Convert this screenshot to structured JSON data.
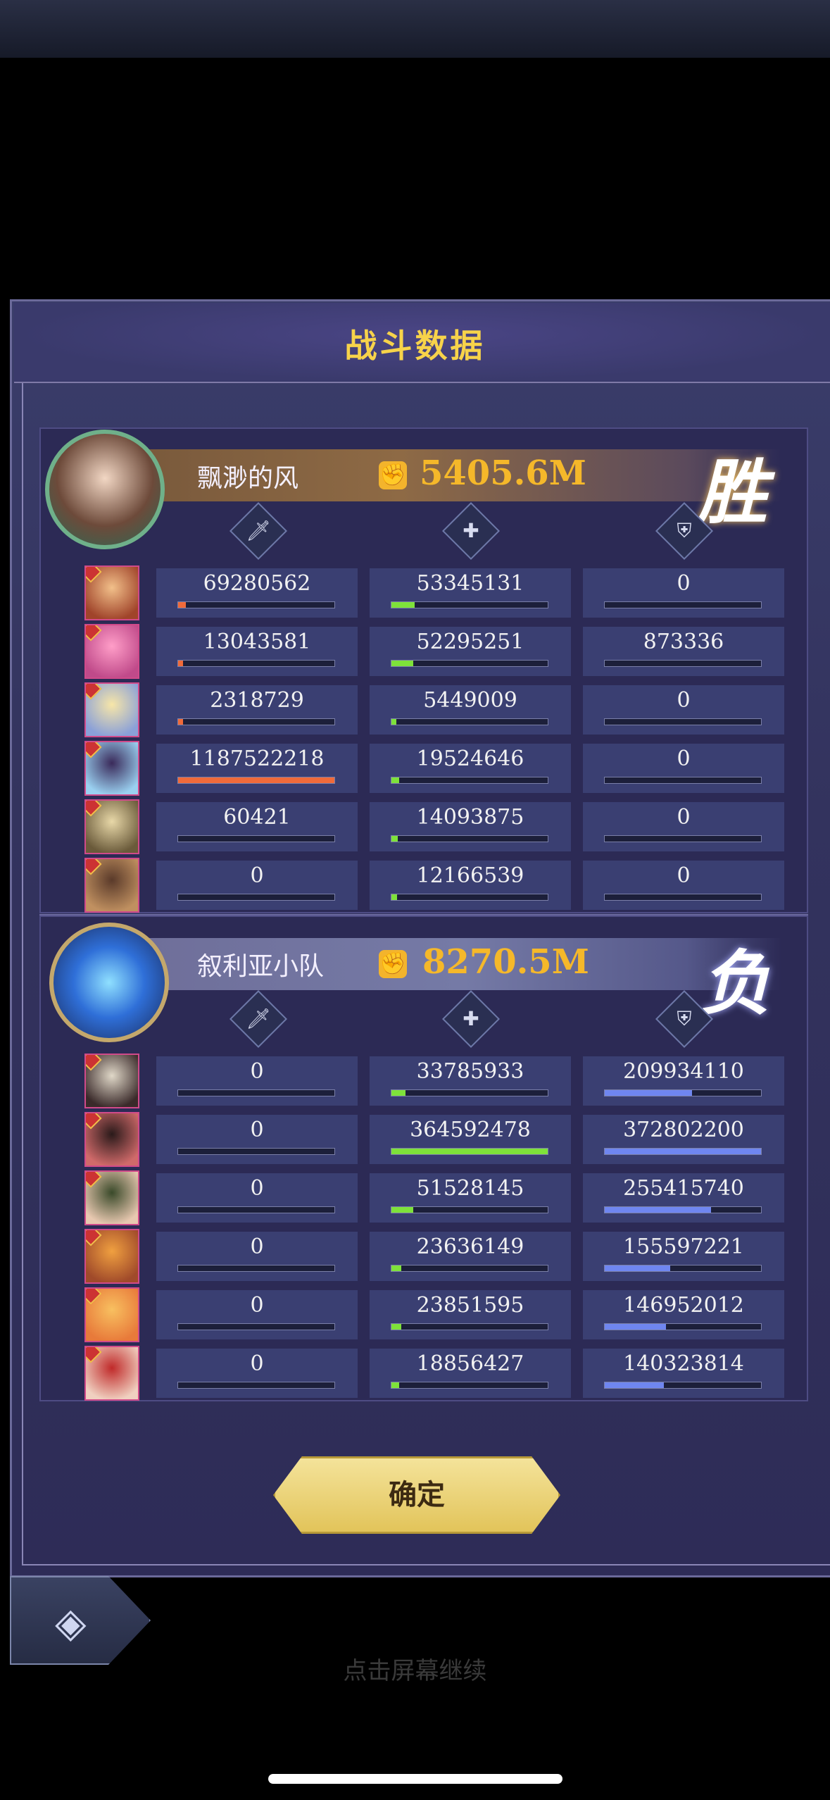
{
  "title": "战斗数据",
  "team1": {
    "name": "飘渺的风",
    "power": "5405.6M",
    "result": "胜",
    "rows": [
      {
        "dmg": "69280562",
        "dmg_pct": 0.05,
        "heal": "53345131",
        "heal_pct": 0.15,
        "tank": "0",
        "tank_pct": 0
      },
      {
        "dmg": "13043581",
        "dmg_pct": 0.01,
        "heal": "52295251",
        "heal_pct": 0.14,
        "tank": "873336",
        "tank_pct": 0
      },
      {
        "dmg": "2318729",
        "dmg_pct": 0.002,
        "heal": "5449009",
        "heal_pct": 0.015,
        "tank": "0",
        "tank_pct": 0
      },
      {
        "dmg": "1187522218",
        "dmg_pct": 1.0,
        "heal": "19524646",
        "heal_pct": 0.05,
        "tank": "0",
        "tank_pct": 0
      },
      {
        "dmg": "60421",
        "dmg_pct": 0,
        "heal": "14093875",
        "heal_pct": 0.04,
        "tank": "0",
        "tank_pct": 0
      },
      {
        "dmg": "0",
        "dmg_pct": 0,
        "heal": "12166539",
        "heal_pct": 0.035,
        "tank": "0",
        "tank_pct": 0
      }
    ]
  },
  "team2": {
    "name": "叙利亚小队",
    "power": "8270.5M",
    "result": "负",
    "rows": [
      {
        "dmg": "0",
        "dmg_pct": 0,
        "heal": "33785933",
        "heal_pct": 0.09,
        "tank": "209934110",
        "tank_pct": 0.56
      },
      {
        "dmg": "0",
        "dmg_pct": 0,
        "heal": "364592478",
        "heal_pct": 1.0,
        "tank": "372802200",
        "tank_pct": 1.0
      },
      {
        "dmg": "0",
        "dmg_pct": 0,
        "heal": "51528145",
        "heal_pct": 0.14,
        "tank": "255415740",
        "tank_pct": 0.68
      },
      {
        "dmg": "0",
        "dmg_pct": 0,
        "heal": "23636149",
        "heal_pct": 0.065,
        "tank": "155597221",
        "tank_pct": 0.42
      },
      {
        "dmg": "0",
        "dmg_pct": 0,
        "heal": "23851595",
        "heal_pct": 0.065,
        "tank": "146952012",
        "tank_pct": 0.39
      },
      {
        "dmg": "0",
        "dmg_pct": 0,
        "heal": "18856427",
        "heal_pct": 0.05,
        "tank": "140323814",
        "tank_pct": 0.38
      }
    ]
  },
  "colors": {
    "dmg": "#f06a3a",
    "heal": "#7ee23a",
    "tank": "#6f86f0",
    "gold": "#f5b82a"
  },
  "icons": {
    "damage": "sword-icon",
    "heal": "heart-plus-icon",
    "tank": "shield-icon",
    "power": "fist-icon",
    "back": "back-arrow-icon"
  },
  "confirm_label": "确定",
  "hint": "点击屏幕继续"
}
